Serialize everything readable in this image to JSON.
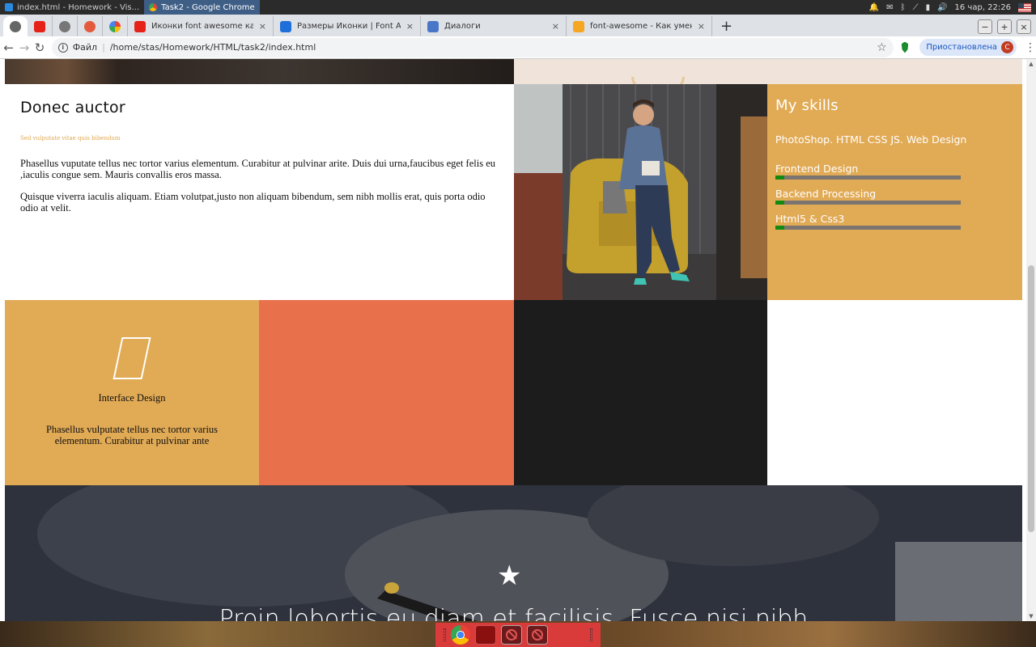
{
  "os_panel": {
    "tasks": [
      {
        "label": "index.html - Homework - Vis..."
      },
      {
        "label": "Task2 - Google Chrome"
      }
    ],
    "clock": "16 чар, 22:26"
  },
  "browser": {
    "tabs": [
      {
        "label": "Иконки font awesome как под",
        "favicon_color": "#e62117"
      },
      {
        "label": "Размеры Иконки | Font Awes",
        "favicon_color": "#1e6fd9"
      },
      {
        "label": "Диалоги",
        "favicon_color": "#4a76c8"
      },
      {
        "label": "font-awesome - Как уменьши",
        "favicon_color": "#f5a623"
      }
    ],
    "new_tab": "+",
    "window_buttons": {
      "minimize": "−",
      "maximize": "+",
      "close": "×"
    },
    "url_scheme_label": "Файл",
    "url": "/home/stas/Homework/HTML/task2/index.html",
    "paused_label": "Приостановлена",
    "avatar_letter": "C"
  },
  "page": {
    "article": {
      "heading": "Donec auctor",
      "subheading": "Sed vulputate vitae quis bibendum",
      "paragraph1": "Phasellus vuputate tellus nec tortor varius elementum. Curabitur at pulvinar arite. Duis dui urna,faucibus eget felis eu ,iaculis congue sem. Mauris convallis eros massa.",
      "paragraph2": "Quisque viverra iaculis aliquam. Etiam volutpat,justo non aliquam bibendum, sem nibh mollis erat, quis porta odio odio at velit."
    },
    "skills": {
      "heading": "My skills",
      "list": "PhotoShop. HTML CSS JS. Web Design",
      "items": [
        {
          "name": "Frontend Design",
          "progress": 0.05
        },
        {
          "name": "Backend Processing",
          "progress": 0.05
        },
        {
          "name": "Html5 & Css3",
          "progress": 0.05
        }
      ],
      "bar_fill_color": "#128a12"
    },
    "service": {
      "title": "Interface Design",
      "description": "Phasellus vulputate tellus nec tortor varius elementum. Curabitur at pulvinar ante"
    },
    "quote": {
      "icon": "star-icon",
      "text": "Proin lobortis eu diam et facilisis. Fusce nisi nibh"
    },
    "colors": {
      "accent_orange": "#e1aa55",
      "coral": "#e8714c",
      "dark": "#1c1c1c"
    }
  }
}
